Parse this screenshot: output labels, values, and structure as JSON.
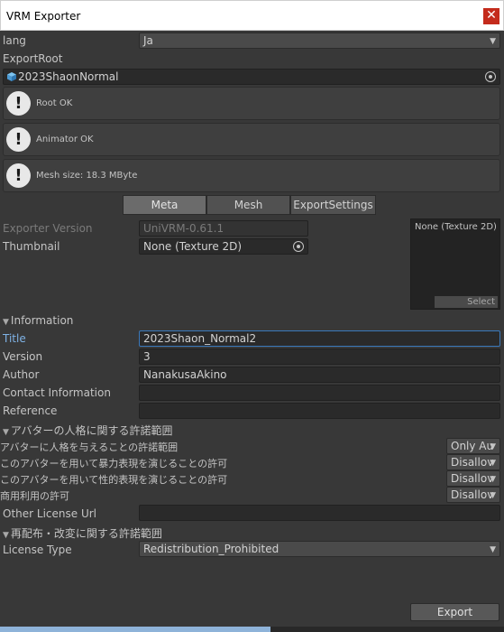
{
  "window": {
    "title": "VRM Exporter",
    "close_glyph": "✕"
  },
  "lang": {
    "label": "lang",
    "value": "Ja"
  },
  "export_root": {
    "label": "ExportRoot",
    "value": "2023ShaonNormal",
    "icon": "prefab-cube-icon"
  },
  "help": [
    {
      "text": "Root OK"
    },
    {
      "text": "Animator OK"
    },
    {
      "text": "Mesh size: 18.3 MByte"
    }
  ],
  "tabs": [
    {
      "label": "Meta",
      "selected": true
    },
    {
      "label": "Mesh",
      "selected": false
    },
    {
      "label": "ExportSettings",
      "selected": false
    }
  ],
  "meta": {
    "exporter_version_label": "Exporter Version",
    "exporter_version_value": "UniVRM-0.61.1",
    "thumbnail_label": "Thumbnail",
    "thumbnail_value": "None (Texture 2D)",
    "preview_text": "None (Texture 2D)",
    "preview_select": "Select"
  },
  "information": {
    "header": "Information",
    "fields": [
      {
        "label": "Title",
        "value": "2023Shaon_Normal2"
      },
      {
        "label": "Version",
        "value": "3"
      },
      {
        "label": "Author",
        "value": "NanakusaAkino"
      },
      {
        "label": "Contact Information",
        "value": ""
      },
      {
        "label": "Reference",
        "value": ""
      }
    ]
  },
  "avatar_permission": {
    "header": "アバターの人格に関する許諾範囲",
    "rows": [
      {
        "label": "アバターに人格を与えることの許諾範囲",
        "value": "Only Au"
      },
      {
        "label": "このアバターを用いて暴力表現を演じることの許可",
        "value": "Disallov"
      },
      {
        "label": "このアバターを用いて性的表現を演じることの許可",
        "value": "Disallov"
      },
      {
        "label": "商用利用の許可",
        "value": "Disallov"
      }
    ],
    "other_license_label": "Other License Url",
    "other_license_value": ""
  },
  "redistribution": {
    "header": "再配布・改変に関する許諾範囲",
    "license_type_label": "License Type",
    "license_type_value": "Redistribution_Prohibited"
  },
  "export_button": "Export",
  "colors": {
    "background": "#383838",
    "field": "#2a2a2a",
    "accent": "#3a79bb",
    "title_link": "#7fb2e5"
  }
}
